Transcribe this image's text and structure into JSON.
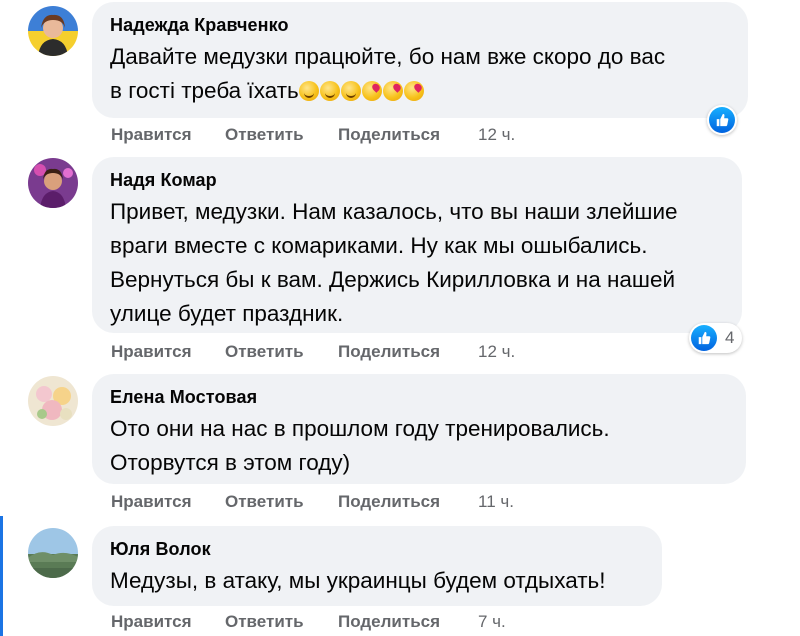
{
  "comments": [
    {
      "author": "Надежда Кравченко",
      "line1": "Давайте медузки працюйте, бо нам вже скоро до вас",
      "line2": "в гості треба їхать",
      "emojis": [
        "smirk-face-emoji",
        "smirk-face-emoji",
        "smirk-face-emoji",
        "kiss-face-emoji",
        "kiss-face-emoji",
        "kiss-face-emoji"
      ],
      "like_label": "Нравится",
      "reply_label": "Ответить",
      "share_label": "Поделиться",
      "time": "12 ч.",
      "reaction": "like"
    },
    {
      "author": "Надя Комар",
      "lines": [
        "Привет, медузки. Нам казалось, что вы наши злейшие",
        "враги вместе с комариками. Ну как мы ошыбались.",
        "Вернуться бы к вам. Держись Кирилловка и на нашей",
        "улице будет праздник."
      ],
      "like_label": "Нравится",
      "reply_label": "Ответить",
      "share_label": "Поделиться",
      "time": "12 ч.",
      "reaction": "like",
      "reaction_count": "4"
    },
    {
      "author": "Елена Мостовая",
      "lines": [
        "Ото они на нас в прошлом году тренировались.",
        "Оторвутся в этом году)"
      ],
      "like_label": "Нравится",
      "reply_label": "Ответить",
      "share_label": "Поделиться",
      "time": "11 ч."
    },
    {
      "author": "Юля Волок",
      "lines": [
        "Медузы, в атаку, мы украинцы будем отдыхать!"
      ],
      "like_label": "Нравится",
      "reply_label": "Ответить",
      "share_label": "Поделиться",
      "time": "7 ч."
    }
  ],
  "colors": {
    "bubble": "#f0f2f5",
    "meta_text": "#65676b",
    "like_blue": "#0866ff",
    "thread_line": "#1b74e4"
  }
}
